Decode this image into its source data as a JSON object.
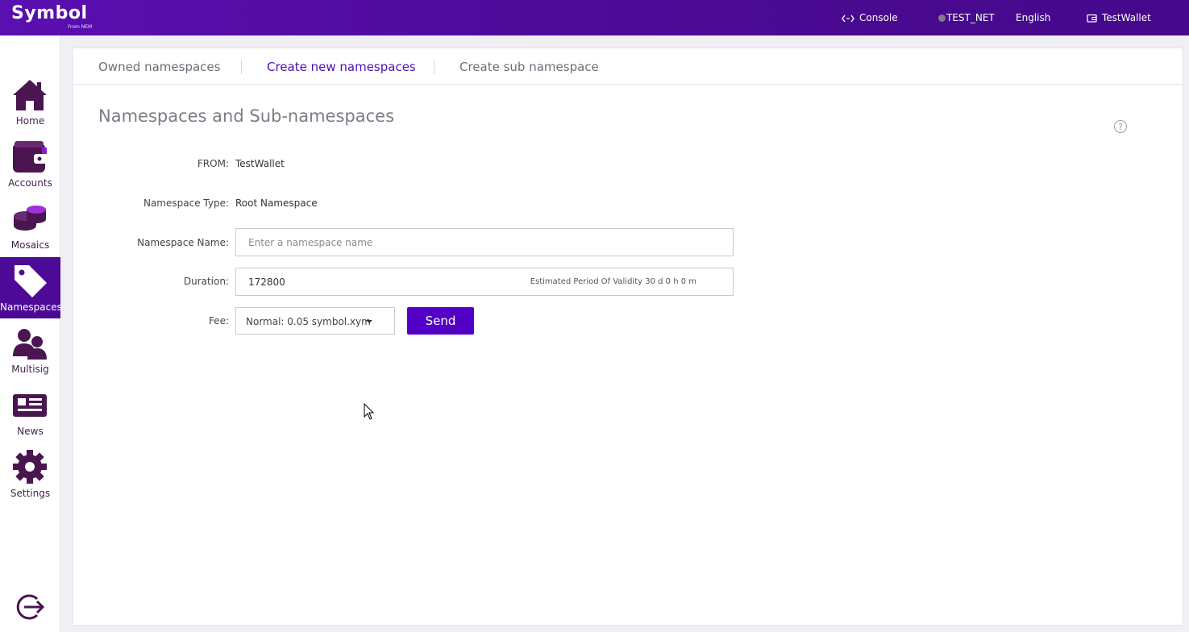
{
  "header": {
    "logo": "Symbol",
    "logo_sub": "From NEM",
    "console": "Console",
    "network": "TEST_NET",
    "language": "English",
    "wallet": "TestWallet"
  },
  "sidebar": {
    "items": [
      {
        "label": "Home",
        "icon": "home-icon"
      },
      {
        "label": "Accounts",
        "icon": "wallet-icon"
      },
      {
        "label": "Mosaics",
        "icon": "coins-icon"
      },
      {
        "label": "Namespaces",
        "icon": "tag-icon",
        "active": true
      },
      {
        "label": "Multisig",
        "icon": "users-icon"
      },
      {
        "label": "News",
        "icon": "newspaper-icon"
      },
      {
        "label": "Settings",
        "icon": "gear-icon"
      }
    ],
    "logout_icon": "logout-icon"
  },
  "tabs": [
    {
      "label": "Owned namespaces"
    },
    {
      "label": "Create new namespaces",
      "active": true
    },
    {
      "label": "Create sub namespace"
    }
  ],
  "form": {
    "title": "Namespaces and Sub-namespaces",
    "from_label": "FROM:",
    "from_value": "TestWallet",
    "type_label": "Namespace Type:",
    "type_value": "Root Namespace",
    "name_label": "Namespace Name:",
    "name_placeholder": "Enter a namespace name",
    "duration_label": "Duration:",
    "duration_value": "172800",
    "duration_hint": "Estimated Period Of Validity 30 d 0 h 0 m",
    "fee_label": "Fee:",
    "fee_value": "Normal: 0.05 symbol.xym",
    "send_label": "Send"
  },
  "colors": {
    "brand": "#5200c6",
    "sidebar_icon": "#4a1550",
    "active_nav": "#4d0a96"
  }
}
